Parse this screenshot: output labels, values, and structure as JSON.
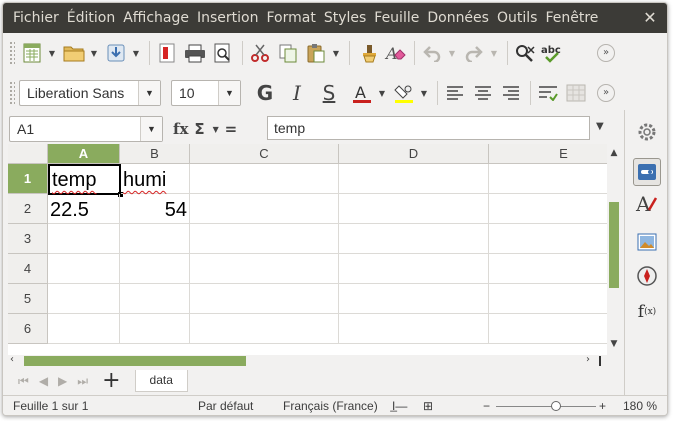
{
  "menu": {
    "items": [
      "Fichier",
      "Édition",
      "Affichage",
      "Insertion",
      "Format",
      "Styles",
      "Feuille",
      "Données",
      "Outils",
      "Fenêtre"
    ],
    "close_glyph": "✕"
  },
  "toolbar": {
    "overflow_glyph": "»"
  },
  "format_toolbar": {
    "font_name": "Liberation Sans",
    "font_size": "10",
    "bold": "G",
    "italic": "I",
    "strike": "S",
    "font_color_hex": "#c9211e",
    "highlight_color_hex": "#ffff00"
  },
  "formula_bar": {
    "name_box": "A1",
    "fx_label": "fx",
    "sigma_label": "Σ",
    "equals_label": "=",
    "content": "temp"
  },
  "grid": {
    "columns": [
      "A",
      "B",
      "C",
      "D",
      "E"
    ],
    "rows": [
      "1",
      "2",
      "3",
      "4",
      "5",
      "6"
    ],
    "cells": {
      "A1": "temp",
      "B1": "humi",
      "A2": "22.5",
      "B2": "54"
    },
    "selected_cell": "A1",
    "accent_hex": "#8aab5e"
  },
  "tabs": {
    "add_glyph": "+",
    "sheets": [
      "data"
    ]
  },
  "status": {
    "sheet_info": "Feuille 1 sur 1",
    "page_style": "Par défaut",
    "language": "Français (France)",
    "zoom_minus": "−",
    "zoom_plus": "+",
    "zoom_percent": "180 %",
    "zoom_level_fraction": 0.6
  }
}
